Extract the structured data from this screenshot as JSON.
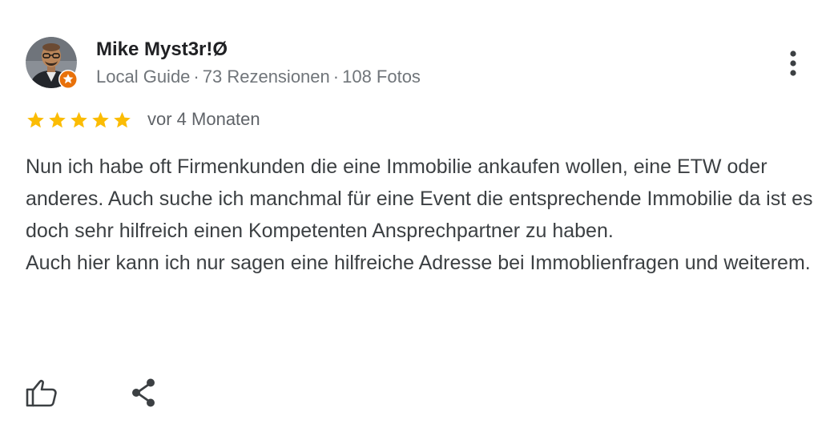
{
  "reviewer": {
    "name": "Mike Myst3r!Ø",
    "badge": "Local Guide",
    "reviews": "73 Rezensionen",
    "photos": "108 Fotos",
    "separator": "·"
  },
  "rating": {
    "stars": 5,
    "max": 5,
    "date": "vor 4 Monaten"
  },
  "review": {
    "paragraphs": [
      "Nun ich habe oft Firmenkunden die eine Immobilie ankaufen wollen, eine ETW oder anderes. Auch suche ich manchmal für eine Event die entsprechende Immobilie da ist es doch sehr hilfreich einen Kompetenten Ansprechpartner zu haben.",
      "Auch hier kann ich nur sagen eine hilfreiche Adresse bei Immoblienfragen und weiterem."
    ]
  },
  "actions": {
    "like_icon": "thumb-up-outline-icon",
    "share_icon": "share-icon",
    "more_icon": "more-vert-icon"
  },
  "colors": {
    "star": "#fbbc04",
    "badge": "#e8710a",
    "text_primary": "#202124",
    "text_secondary": "#70757a",
    "icon": "#3c4043"
  }
}
